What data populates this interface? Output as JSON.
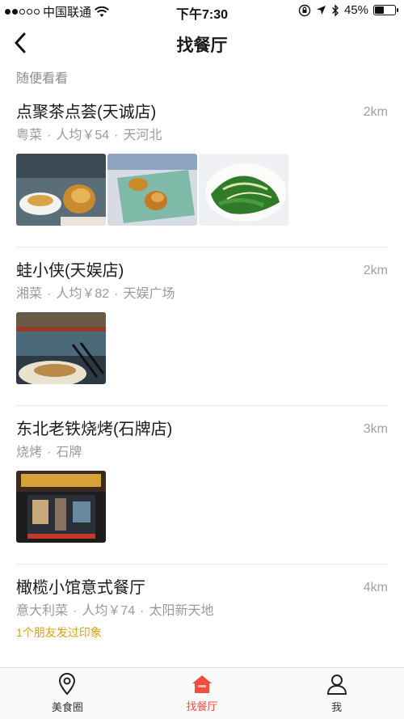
{
  "status": {
    "carrier": "中国联通",
    "time": "下午7:30",
    "battery": "45%",
    "battery_level": 0.45
  },
  "nav": {
    "title": "找餐厅"
  },
  "section_hint": "随便看看",
  "restaurants": [
    {
      "name": "点聚茶点荟(天诚店)",
      "distance": "2km",
      "meta": [
        "粤菜",
        "人均￥54",
        "天河北"
      ]
    },
    {
      "name": "蛙小侠(天娱店)",
      "distance": "2km",
      "meta": [
        "湘菜",
        "人均￥82",
        "天娱广场"
      ]
    },
    {
      "name": "东北老铁烧烤(石牌店)",
      "distance": "3km",
      "meta": [
        "烧烤",
        "石牌"
      ]
    },
    {
      "name": "橄榄小馆意式餐厅",
      "distance": "4km",
      "meta": [
        "意大利菜",
        "人均￥74",
        "太阳新天地"
      ],
      "note": "1个朋友发过印象"
    }
  ],
  "tabs": [
    {
      "label": "美食圈",
      "icon": "location-pin-icon"
    },
    {
      "label": "找餐厅",
      "icon": "house-icon"
    },
    {
      "label": "我",
      "icon": "person-icon"
    }
  ],
  "colors": {
    "accent": "#f04e3e",
    "note": "#d9a011"
  }
}
